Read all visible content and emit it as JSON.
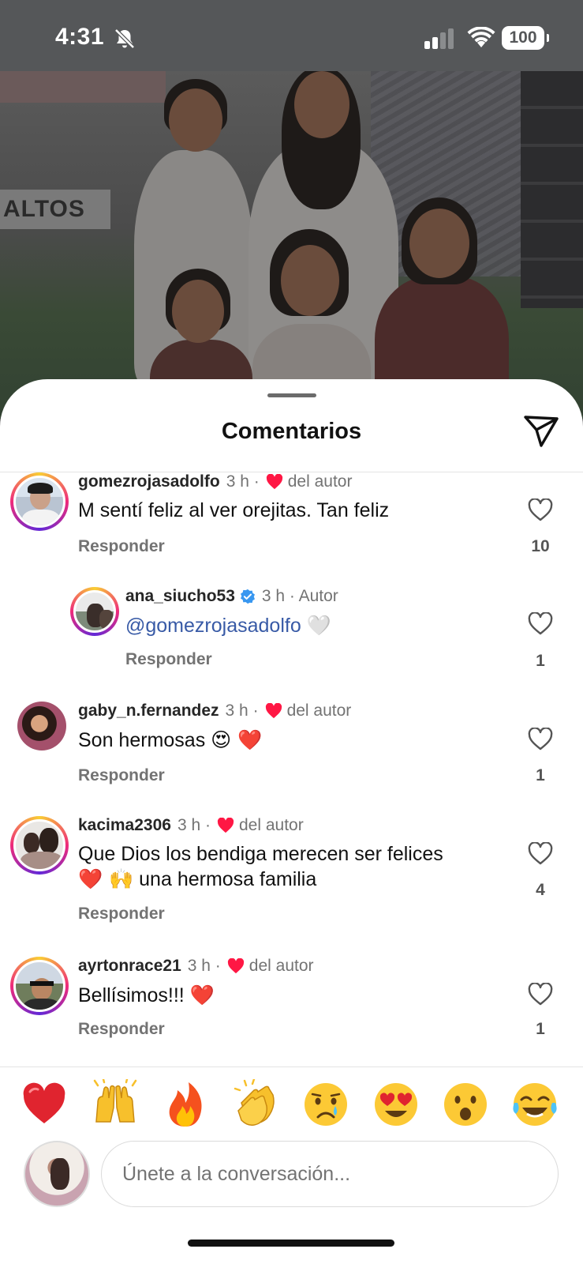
{
  "status_bar": {
    "time": "4:31",
    "battery": "100"
  },
  "photo_banner": "ALTOS",
  "sheet": {
    "title": "Comentarios"
  },
  "comments": [
    {
      "user": "gomezrojasadolfo",
      "time": "3 h ·",
      "liked_by_author": "del autor",
      "text": "M sentí feliz al ver  orejitas.  Tan feliz",
      "reply": "Responder",
      "likes": "10"
    },
    {
      "user": "ana_siucho53",
      "time": "3 h · Autor",
      "mention": "@gomezrojasadolfo",
      "emoji": "🤍",
      "reply": "Responder",
      "likes": "1"
    },
    {
      "user": "gaby_n.fernandez",
      "time": "3 h ·",
      "liked_by_author": "del autor",
      "text": "Son hermosas",
      "emoji": "😍 ❤️",
      "reply": "Responder",
      "likes": "1"
    },
    {
      "user": "kacima2306",
      "time": "3 h ·",
      "liked_by_author": "del autor",
      "text": "Que Dios los bendiga merecen ser felices",
      "text2_emoji": "❤️ 🙌",
      "text2": "una hermosa familia",
      "reply": "Responder",
      "likes": "4"
    },
    {
      "user": "ayrtonrace21",
      "time": "3 h ·",
      "liked_by_author": "del autor",
      "text": "Bellísimos!!!",
      "emoji": "❤️",
      "reply": "Responder",
      "likes": "1"
    }
  ],
  "reactions": [
    "red-heart",
    "raising-hands",
    "fire",
    "clapping-hands",
    "crying-face",
    "heart-eyes-face",
    "surprised-face",
    "tears-of-joy-face"
  ],
  "composer": {
    "placeholder": "Únete a la conversación..."
  },
  "colors": {
    "mention": "#385aa6",
    "heart": "#ff1744",
    "verified": "#3897f0"
  }
}
